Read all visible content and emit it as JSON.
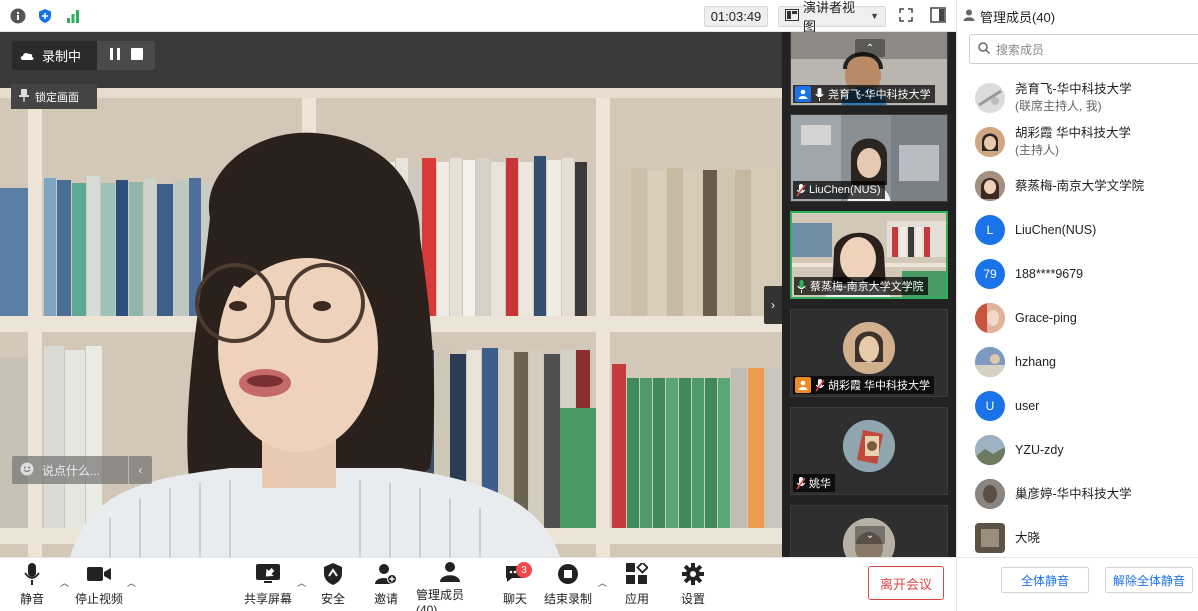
{
  "topbar": {
    "timer": "01:03:49",
    "view_label": "演讲者视图",
    "icons": [
      "info-icon",
      "shield-icon",
      "signal-icon",
      "speaker-view-icon",
      "fullscreen-icon",
      "side-panel-icon"
    ]
  },
  "stage": {
    "recording_label": "录制中",
    "lock_label": "锁定画面",
    "chat_placeholder": "说点什么..."
  },
  "thumbnails": [
    {
      "name": "尧育飞-华中科技大学",
      "mic": "unmuted",
      "host_badge": true
    },
    {
      "name": "LiuChen(NUS)",
      "mic": "muted"
    },
    {
      "name": "蔡蒸梅-南京大学文学院",
      "mic": "speaking",
      "active": true
    },
    {
      "name": "胡彩霞 华中科技大学",
      "mic": "muted",
      "host_badge": true
    },
    {
      "name": "姚华",
      "mic": "muted"
    },
    {
      "name": "",
      "mic": ""
    }
  ],
  "panel": {
    "title": "管理成员(40)",
    "search_placeholder": "搜索成员",
    "members": [
      {
        "name": "尧育飞-华中科技大学",
        "sub": "(联席主持人, 我)",
        "avatar": "photo",
        "color": "#cfcfcf"
      },
      {
        "name": "胡彩霞 华中科技大学",
        "sub": "(主持人)",
        "avatar": "photo",
        "color": "#b98d6a"
      },
      {
        "name": "蔡蒸梅-南京大学文学院",
        "sub": "",
        "avatar": "photo",
        "color": "#8a7060"
      },
      {
        "name": "LiuChen(NUS)",
        "sub": "",
        "avatar": "L",
        "color": "#1a73e8"
      },
      {
        "name": "188****9679",
        "sub": "",
        "avatar": "79",
        "color": "#1a73e8"
      },
      {
        "name": "Grace-ping",
        "sub": "",
        "avatar": "photo",
        "color": "#c9765f"
      },
      {
        "name": "hzhang",
        "sub": "",
        "avatar": "photo",
        "color": "#6f8fb8"
      },
      {
        "name": "user",
        "sub": "",
        "avatar": "U",
        "color": "#1a73e8"
      },
      {
        "name": "YZU-zdy",
        "sub": "",
        "avatar": "photo",
        "color": "#7a8a98"
      },
      {
        "name": "巢彦婷-华中科技大学",
        "sub": "",
        "avatar": "photo",
        "color": "#6a6a6a"
      },
      {
        "name": "大晓",
        "sub": "",
        "avatar": "photo",
        "color": "#8a8070"
      }
    ],
    "mute_all": "全体静音",
    "unmute_all": "解除全体静音"
  },
  "toolbar": {
    "mute": "静音",
    "stop_video": "停止视频",
    "share": "共享屏幕",
    "security": "安全",
    "invite": "邀请",
    "participants": "管理成员(40)",
    "chat": "聊天",
    "chat_badge": "3",
    "end_recording": "结束录制",
    "apps": "应用",
    "settings": "设置",
    "leave": "离开会议"
  },
  "colors": {
    "accent": "#1a73e8",
    "leave_red": "#e04646",
    "speaking_green": "#2eb05b"
  }
}
